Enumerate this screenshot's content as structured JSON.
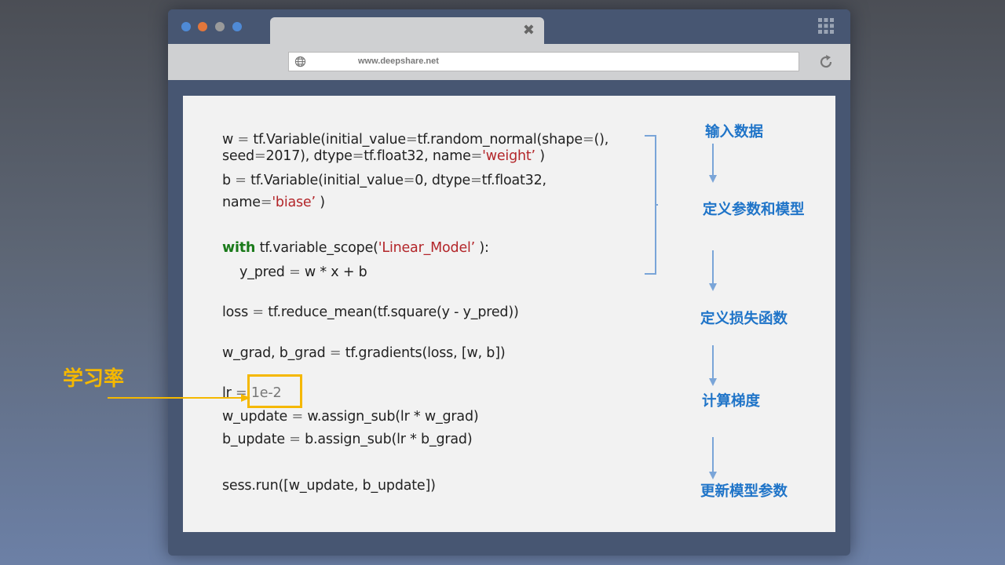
{
  "browser": {
    "url": "www.deepshare.net",
    "tab_close_icon": "close-icon",
    "window_dot_colors": [
      "#4f8ad6",
      "#e4773b",
      "#9a9a9a",
      "#4f8ad6"
    ]
  },
  "code": {
    "line1": {
      "a": "w ",
      "eq1": "=",
      "b": " tf.Variable(initial_value",
      "eq2": "=",
      "c": "tf.random_normal(shape",
      "eq3": "=",
      "d": "(),"
    },
    "line2": {
      "a": "seed",
      "eq1": "=",
      "b": "2017), dtype",
      "eq2": "=",
      "c": "tf.float32, name",
      "eq3": "=",
      "str": "'weight’",
      "d": " )"
    },
    "line3": {
      "a": "b ",
      "eq1": "=",
      "b": " tf.Variable(initial_value",
      "eq2": "=",
      "c": "0, dtype",
      "eq3": "=",
      "d": "tf.float32,"
    },
    "line4": {
      "a": "name",
      "eq1": "=",
      "str": "'biase’",
      "d": " )"
    },
    "line5": {
      "kw": "with",
      "a": " tf.variable_scope(",
      "str": "'Linear_Model’",
      "d": " ):"
    },
    "line6": {
      "a": "y_pred ",
      "eq1": "=",
      "b": " w * x + b"
    },
    "line7": {
      "a": "loss ",
      "eq1": "=",
      "b": " tf.reduce_mean(tf.square(y - y_pred))"
    },
    "line8": {
      "a": "w_grad, b_grad ",
      "eq1": "=",
      "b": " tf.gradients(loss, [w, b])"
    },
    "line9": {
      "a": "lr ",
      "eq1": "=",
      "val": " 1e-2"
    },
    "line10": {
      "a": "w_update ",
      "eq1": "=",
      "b": " w.assign_sub(lr * w_grad)"
    },
    "line11": {
      "a": "b_update ",
      "eq1": "=",
      "b": " b.assign_sub(lr * b_grad)"
    },
    "line12": {
      "a": "sess.run([w_update, b_update])"
    }
  },
  "steps": [
    "输入数据",
    "定义参数和模型",
    "定义损失函数",
    "计算梯度",
    "更新模型参数"
  ],
  "annotation": {
    "label": "学习率"
  },
  "colors": {
    "step_text": "#1f74c8",
    "annotation": "#f5b800",
    "string": "#b3262a",
    "keyword": "#1a7a1a",
    "flow_arrow": "#7aa5d8"
  }
}
